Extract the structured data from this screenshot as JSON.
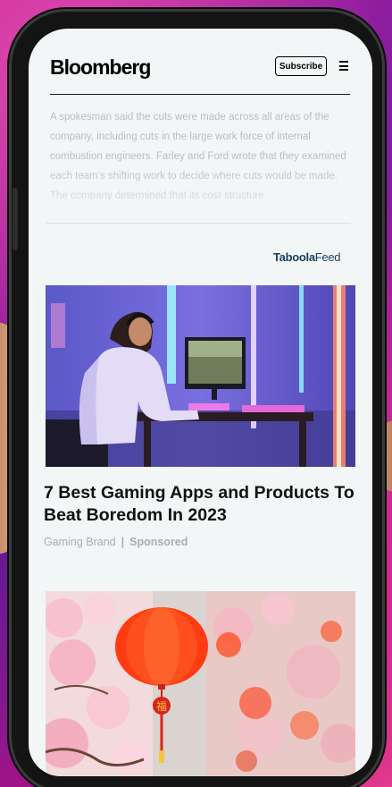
{
  "header": {
    "logo": "Bloomberg",
    "subscribe_label": "Subscribe",
    "menu_icon": "hamburger-menu-icon"
  },
  "article": {
    "faded_text": "A spokesman said the cuts were made across all areas of the company, including cuts in the large work force of internal combustion engineers. Farley and Ford wrote that they examined each team’s shifting work to decide where cuts would be made. The company determined that its cost structure"
  },
  "feed": {
    "taboola_brand": "Taboola",
    "taboola_feed": "Feed",
    "cards": [
      {
        "title": "7 Best Gaming Apps and Products To Beat Boredom In 2023",
        "source": "Gaming Brand",
        "separator": "|",
        "sponsored": "Sponsored"
      }
    ],
    "second_card_image_glyph": "福"
  },
  "colors": {
    "background_pink": "#c2188f",
    "background_purple": "#7b1fa2",
    "screen_bg": "#f3f6f7",
    "taboola_blue": "#1a3f5c",
    "faded_text": "#b9bec2",
    "meta_text": "#a9adb1"
  }
}
